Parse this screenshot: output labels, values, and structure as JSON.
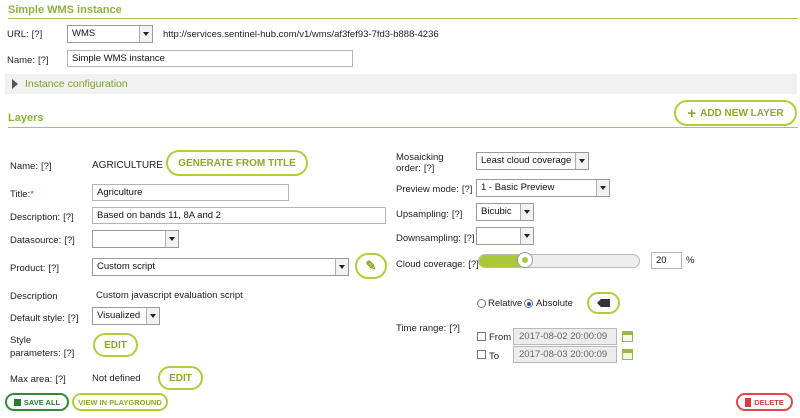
{
  "header": {
    "title": "Simple WMS instance"
  },
  "url": {
    "label": "URL:",
    "help": "[?]",
    "type_value": "WMS",
    "value": "http://services.sentinel-hub.com/v1/wms/af3fef93-7fd3-b888-4236"
  },
  "name": {
    "label": "Name:",
    "help": "[?]",
    "value": "Simple WMS instance"
  },
  "instance_config": {
    "label": "Instance configuration"
  },
  "layers": {
    "title": "Layers",
    "add_button": "ADD NEW LAYER",
    "name": {
      "label": "Name:",
      "help": "[?]",
      "value": "AGRICULTURE",
      "generate_button": "GENERATE FROM TITLE"
    },
    "title_field": {
      "label": "Title:",
      "required_mark": "*",
      "value": "Agriculture"
    },
    "description": {
      "label": "Description:",
      "help": "[?]",
      "value": "Based on bands 11, 8A and 2"
    },
    "datasource": {
      "label": "Datasource:",
      "help": "[?]",
      "value": ""
    },
    "product": {
      "label": "Product:",
      "help": "[?]",
      "value": "Custom script"
    },
    "description2": {
      "label": "Description",
      "value": "Custom javascript evaluation script"
    },
    "default_style": {
      "label": "Default style:",
      "help": "[?]",
      "value": "Visualized"
    },
    "style_params": {
      "label_line1": "Style",
      "label_line2": "parameters:",
      "help": "[?]",
      "edit_button": "EDIT"
    },
    "max_area": {
      "label": "Max area:",
      "help": "[?]",
      "value": "Not defined",
      "edit_button": "EDIT"
    },
    "mosaicking": {
      "label_line1": "Mosaicking",
      "label_line2": "order:",
      "help": "[?]",
      "value": "Least cloud coverage"
    },
    "preview": {
      "label": "Preview mode:",
      "help": "[?]",
      "value": "1 - Basic Preview"
    },
    "upsampling": {
      "label": "Upsampling:",
      "help": "[?]",
      "value": "Bicubic"
    },
    "downsampling": {
      "label": "Downsampling:",
      "help": "[?]",
      "value": ""
    },
    "cloud": {
      "label": "Cloud coverage:",
      "help": "[?]",
      "value": "20",
      "unit": "%",
      "slider_fraction": 0.2
    },
    "time_range": {
      "label": "Time range:",
      "help": "[?]",
      "relative_label": "Relative",
      "absolute_label": "Absolute",
      "selected": "Absolute",
      "from_label": "From",
      "from_value": "2017-08-02 20:00:09",
      "to_label": "To",
      "to_value": "2017-08-03 20:00:09"
    }
  },
  "footer": {
    "save_all": "SAVE ALL",
    "view_playground": "VIEW IN PLAYGROUND",
    "delete": "DELETE"
  },
  "colors": {
    "accent": "#8db33a",
    "button_border": "#b4cc3c",
    "danger": "#d94b4b"
  }
}
